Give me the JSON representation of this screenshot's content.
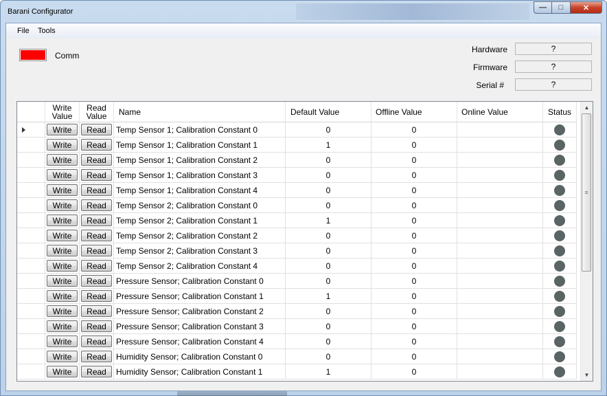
{
  "window": {
    "title": "Barani Configurator",
    "controls": {
      "minimize": "—",
      "maximize": "□",
      "close": "✕"
    }
  },
  "menu": [
    "File",
    "Tools"
  ],
  "comm": {
    "label": "Comm",
    "color": "#ff0000"
  },
  "info": [
    {
      "label": "Hardware",
      "value": "?"
    },
    {
      "label": "Firmware",
      "value": "?"
    },
    {
      "label": "Serial #",
      "value": "?"
    }
  ],
  "grid": {
    "columns": {
      "write": "Write Value",
      "read": "Read Value",
      "name": "Name",
      "default": "Default Value",
      "offline": "Offline Value",
      "online": "Online Value",
      "status": "Status"
    },
    "write_label": "Write",
    "read_label": "Read",
    "status_color": "#5a6464",
    "rows": [
      {
        "name": "Temp Sensor 1; Calibration Constant 0",
        "default": "0",
        "offline": "0",
        "online": ""
      },
      {
        "name": "Temp Sensor 1; Calibration Constant 1",
        "default": "1",
        "offline": "0",
        "online": ""
      },
      {
        "name": "Temp Sensor 1; Calibration Constant 2",
        "default": "0",
        "offline": "0",
        "online": ""
      },
      {
        "name": "Temp Sensor 1; Calibration Constant 3",
        "default": "0",
        "offline": "0",
        "online": ""
      },
      {
        "name": "Temp Sensor 1; Calibration Constant 4",
        "default": "0",
        "offline": "0",
        "online": ""
      },
      {
        "name": "Temp Sensor 2; Calibration Constant 0",
        "default": "0",
        "offline": "0",
        "online": ""
      },
      {
        "name": "Temp Sensor 2; Calibration Constant 1",
        "default": "1",
        "offline": "0",
        "online": ""
      },
      {
        "name": "Temp Sensor 2; Calibration Constant 2",
        "default": "0",
        "offline": "0",
        "online": ""
      },
      {
        "name": "Temp Sensor 2; Calibration Constant 3",
        "default": "0",
        "offline": "0",
        "online": ""
      },
      {
        "name": "Temp Sensor 2; Calibration Constant 4",
        "default": "0",
        "offline": "0",
        "online": ""
      },
      {
        "name": "Pressure Sensor; Calibration Constant 0",
        "default": "0",
        "offline": "0",
        "online": ""
      },
      {
        "name": "Pressure Sensor; Calibration Constant 1",
        "default": "1",
        "offline": "0",
        "online": ""
      },
      {
        "name": "Pressure Sensor; Calibration Constant 2",
        "default": "0",
        "offline": "0",
        "online": ""
      },
      {
        "name": "Pressure Sensor; Calibration Constant 3",
        "default": "0",
        "offline": "0",
        "online": ""
      },
      {
        "name": "Pressure Sensor; Calibration Constant 4",
        "default": "0",
        "offline": "0",
        "online": ""
      },
      {
        "name": "Humidity Sensor; Calibration Constant 0",
        "default": "0",
        "offline": "0",
        "online": ""
      },
      {
        "name": "Humidity Sensor; Calibration Constant 1",
        "default": "1",
        "offline": "0",
        "online": ""
      }
    ]
  }
}
